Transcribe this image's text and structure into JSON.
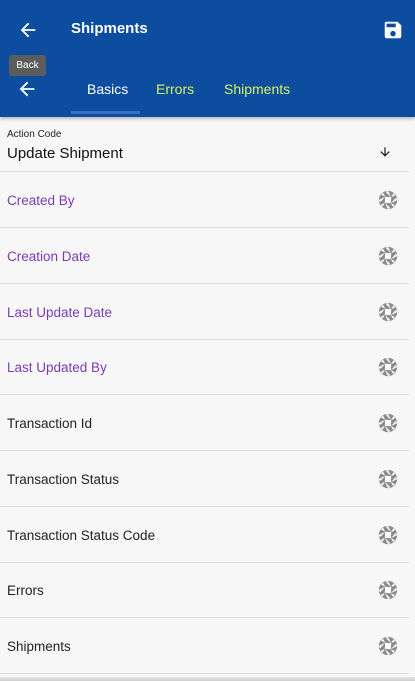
{
  "header": {
    "title": "Shipments",
    "back_tooltip": "Back"
  },
  "tabs": [
    {
      "label": "Basics",
      "active": true
    },
    {
      "label": "Errors",
      "active": false
    },
    {
      "label": "Shipments",
      "active": false
    }
  ],
  "action_code": {
    "label": "Action Code",
    "value": "Update Shipment"
  },
  "rows": [
    {
      "label": "Created By",
      "style": "purple"
    },
    {
      "label": "Creation Date",
      "style": "purple"
    },
    {
      "label": "Last Update Date",
      "style": "purple"
    },
    {
      "label": "Last Updated By",
      "style": "purple"
    },
    {
      "label": "Transaction Id",
      "style": "dark"
    },
    {
      "label": "Transaction Status",
      "style": "dark"
    },
    {
      "label": "Transaction Status Code",
      "style": "dark"
    },
    {
      "label": "Errors",
      "style": "dark"
    },
    {
      "label": "Shipments",
      "style": "dark"
    }
  ],
  "colors": {
    "header_bg": "#0d4da0",
    "active_tab": "#ffffff",
    "inactive_tab": "#d6f25b",
    "purple_label": "#7c3bb6",
    "icon_gray": "#8c8c8c"
  },
  "icons": {
    "back": "arrow-left-icon",
    "save": "floppy-disk-icon",
    "dropdown": "arrow-down-icon",
    "row_action": "aperture-icon"
  }
}
